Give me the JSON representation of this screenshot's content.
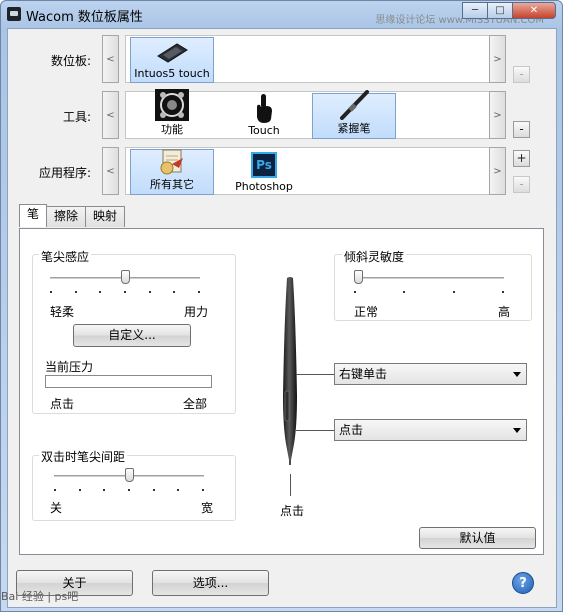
{
  "window": {
    "title": "Wacom 数位板属性",
    "watermark_top": "思缘设计论坛 www.MISSYUAN.COM"
  },
  "tablet_row": {
    "label": "数位板:",
    "items": [
      {
        "label": "Intuos5 touch",
        "selected": true
      }
    ]
  },
  "tool_row": {
    "label": "工具:",
    "items": [
      {
        "label": "功能",
        "selected": false
      },
      {
        "label": "Touch",
        "selected": false
      },
      {
        "label": "紧握笔",
        "selected": true
      }
    ]
  },
  "app_row": {
    "label": "应用程序:",
    "items": [
      {
        "label": "所有其它",
        "selected": true
      },
      {
        "label": "Photoshop",
        "selected": false
      }
    ],
    "ps_icon_text": "Ps"
  },
  "controls": {
    "prev": "<",
    "next": ">",
    "add": "+",
    "remove": "-"
  },
  "tabs": [
    {
      "label": "笔",
      "active": true
    },
    {
      "label": "擦除",
      "active": false
    },
    {
      "label": "映射",
      "active": false
    }
  ],
  "tip_feel": {
    "title": "笔尖感应",
    "min_label": "轻柔",
    "max_label": "用力",
    "level": 0.5,
    "customize_button": "自定义...",
    "current_pressure_label": "当前压力",
    "click_label": "点击",
    "full_label": "全部",
    "pressure_fill": 0
  },
  "tilt": {
    "title": "倾斜灵敏度",
    "min_label": "正常",
    "max_label": "高",
    "level": 0
  },
  "pen": {
    "upper_button": "右键单击",
    "lower_button": "点击",
    "tip_label": "点击"
  },
  "double_click": {
    "title": "双击时笔尖间距",
    "min_label": "关",
    "max_label": "宽",
    "level": 0.5
  },
  "default_button": "默认值",
  "footer": {
    "about_button": "关于",
    "options_button": "选项...",
    "help_icon": "?",
    "watermark_bottom": "Bai 经验 | ps吧"
  }
}
